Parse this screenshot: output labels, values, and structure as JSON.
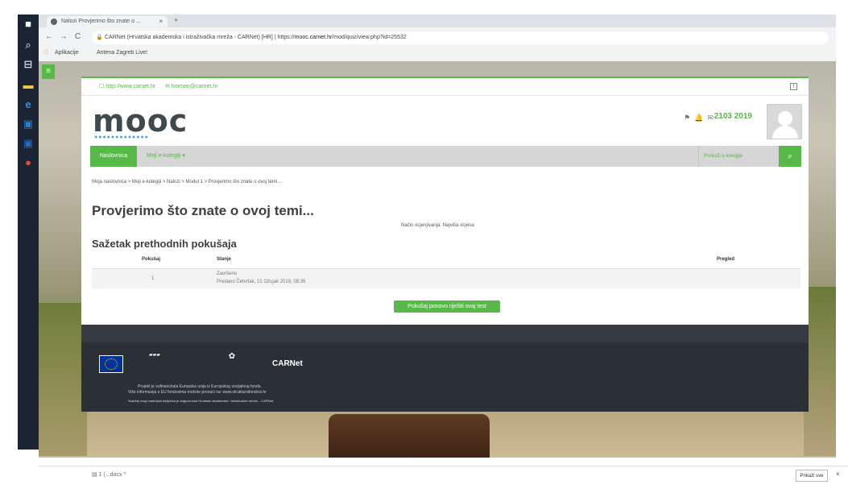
{
  "browser": {
    "tab_title": "Nalozi Provjerimo što znate o ...",
    "tab_close": "×",
    "new_tab": "+",
    "back": "←",
    "forward": "→",
    "reload": "C",
    "address_prefix": "CARNet (Hrvatska akademska i istraživačka mreža - CARNet) [HR] | https://",
    "address_host": "mooc.carnet.hr",
    "address_path": "/mod/quiz/view.php?id=25532",
    "bookmarks": [
      "Aplikacije",
      "Antena Zagreb Live!"
    ]
  },
  "site": {
    "website_link": "http://www.carnet.hr",
    "email_link": "loomen@carnet.hr",
    "logo_text": "mooc",
    "logo_dots": "●●●●●●●●●●●●●",
    "user_name": "2103 2019"
  },
  "nav": {
    "home": "Naslovnica",
    "my_courses": "Moji e-kolegiji ▾",
    "search_placeholder": "Pretraži e-kolegije"
  },
  "breadcrumb": "Moja naslovnica  >  Moji e-kolegiji  >  Nalozi  >  Modul 1  >  Provjerimo što znate o ovoj temi...",
  "quiz": {
    "title": "Provjerimo što znate o ovoj temi...",
    "grading_method": "Način ocjenjivanja: Najviša ocjena",
    "summary_title": "Sažetak prethodnih pokušaja",
    "columns": {
      "attempt": "Pokušaj",
      "state": "Stanje",
      "review": "Pregled"
    },
    "rows": [
      {
        "attempt": "1",
        "state": "Završeno",
        "submitted": "Predano Četvrtak, 21 Ožujak 2019, 08:36"
      }
    ],
    "retry_button": "Pokušaj ponovo riješiti ovaj test"
  },
  "footer": {
    "carnet_logo": "CARNet",
    "line1": "Projekt je sufinancirala Europska unija iz Europskog socijalnog fonda.",
    "line2": "Više informacija o EU fondovima možete pronaći na: www.strukturnifondovi.hr",
    "line3": "Sadržaj ovog materijala isključiva je odgovornost Hrvatske akademske i istraživačke mreže – CARNet."
  },
  "downloads": {
    "item": "1 (...docx",
    "show_all": "Prikaži sve",
    "close": "×"
  }
}
